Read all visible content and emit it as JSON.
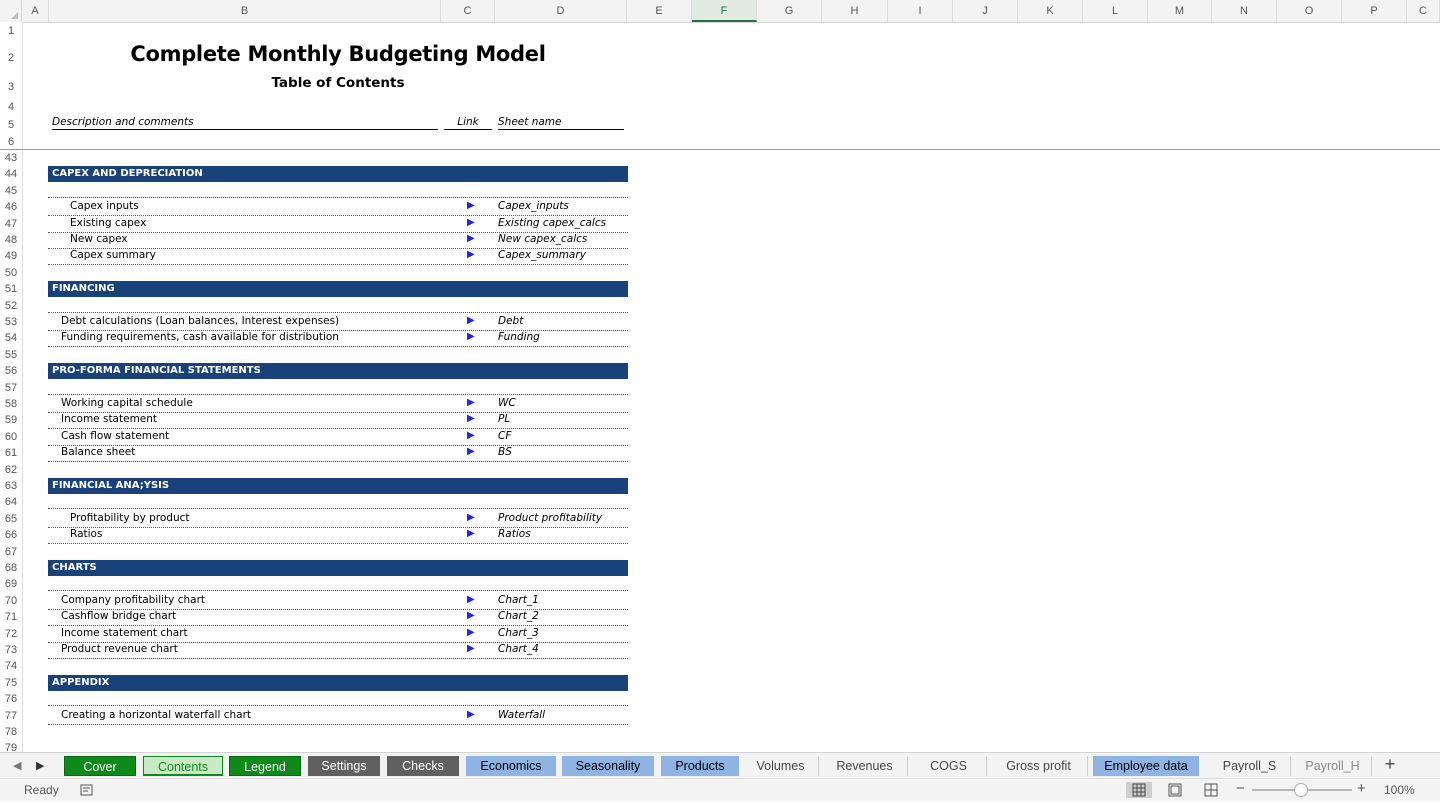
{
  "columns": [
    "A",
    "B",
    "C",
    "D",
    "E",
    "F",
    "G",
    "H",
    "I",
    "J",
    "K",
    "L",
    "M",
    "N",
    "O",
    "P",
    "C"
  ],
  "selected_column": "F",
  "rows_top": [
    "1",
    "2",
    "3",
    "4",
    "5",
    "6"
  ],
  "rows_bottom": [
    "43",
    "44",
    "45",
    "46",
    "47",
    "48",
    "49",
    "50",
    "51",
    "52",
    "53",
    "54",
    "55",
    "56",
    "57",
    "58",
    "59",
    "60",
    "61",
    "62",
    "63",
    "64",
    "65",
    "66",
    "67",
    "68",
    "69",
    "70",
    "71",
    "72",
    "73",
    "74",
    "75",
    "76",
    "77",
    "78",
    "79"
  ],
  "sheet": {
    "title": "Complete Monthly Budgeting Model",
    "subtitle": "Table of Contents",
    "headers": {
      "description": "Description and comments",
      "link": "Link",
      "sheet_name": "Sheet name"
    }
  },
  "sections": [
    {
      "title": "CAPEX AND DEPRECIATION",
      "items": [
        {
          "label": "Capex inputs",
          "sheet": "Capex_inputs"
        },
        {
          "label": "Existing capex",
          "sheet": "Existing capex_calcs"
        },
        {
          "label": "New capex",
          "sheet": "New capex_calcs"
        },
        {
          "label": "Capex summary",
          "sheet": "Capex_summary"
        }
      ]
    },
    {
      "title": "FINANCING",
      "items": [
        {
          "label": "Debt calculations (Loan balances, Interest expenses)",
          "sheet": "Debt"
        },
        {
          "label": "Funding requirements, cash available for distribution",
          "sheet": "Funding"
        }
      ]
    },
    {
      "title": "PRO-FORMA FINANCIAL STATEMENTS",
      "items": [
        {
          "label": "Working capital schedule",
          "sheet": "WC"
        },
        {
          "label": "Income statement",
          "sheet": "PL"
        },
        {
          "label": "Cash flow statement",
          "sheet": "CF"
        },
        {
          "label": "Balance sheet",
          "sheet": "BS"
        }
      ]
    },
    {
      "title": "FINANCIAL ANA;YSIS",
      "items": [
        {
          "label": "Profitability by product",
          "sheet": "Product profitability"
        },
        {
          "label": "Ratios",
          "sheet": "Ratios"
        }
      ]
    },
    {
      "title": "CHARTS",
      "items": [
        {
          "label": "Company profitability chart",
          "sheet": "Chart_1"
        },
        {
          "label": "Cashflow bridge chart",
          "sheet": "Chart_2"
        },
        {
          "label": "Income statement chart",
          "sheet": "Chart_3"
        },
        {
          "label": "Product revenue chart",
          "sheet": "Chart_4"
        }
      ]
    },
    {
      "title": "APPENDIX",
      "items": [
        {
          "label": "Creating a horizontal waterfall chart",
          "sheet": "Waterfall"
        }
      ]
    }
  ],
  "link_icon": "play-triangle-icon",
  "tabs": [
    {
      "label": "Cover",
      "style": "green"
    },
    {
      "label": "Contents",
      "style": "green-active"
    },
    {
      "label": "Legend",
      "style": "green"
    },
    {
      "label": "Settings",
      "style": "grey"
    },
    {
      "label": "Checks",
      "style": "grey"
    },
    {
      "label": "Economics",
      "style": "blue"
    },
    {
      "label": "Seasonality",
      "style": "blue"
    },
    {
      "label": "Products",
      "style": "blue"
    },
    {
      "label": "Volumes",
      "style": "plain"
    },
    {
      "label": "Revenues",
      "style": "plain"
    },
    {
      "label": "COGS",
      "style": "plain"
    },
    {
      "label": "Gross profit",
      "style": "plain"
    },
    {
      "label": "Employee data",
      "style": "blue"
    },
    {
      "label": "Payroll_S",
      "style": "plain"
    },
    {
      "label": "Payroll_H",
      "style": "plain"
    }
  ],
  "add_tab_label": "+",
  "status": {
    "text": "Ready",
    "zoom": "100%"
  },
  "colors": {
    "section_bar": "#1a427a",
    "accent_green": "#217346",
    "link_arrow": "#2222ee"
  }
}
